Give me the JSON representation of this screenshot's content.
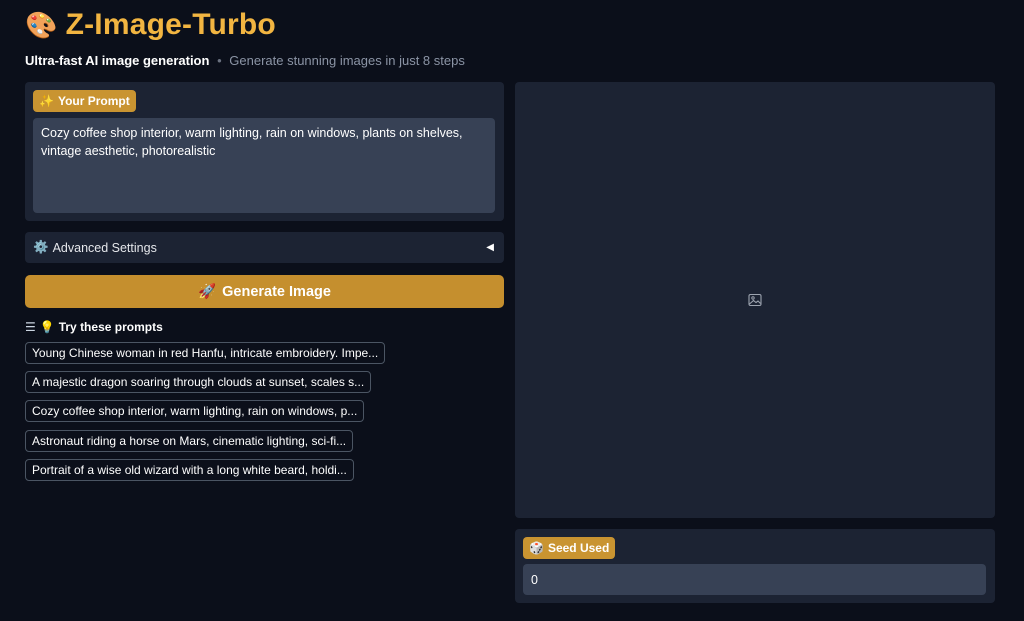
{
  "header": {
    "logo_emoji": "🎨",
    "title": "Z-Image-Turbo",
    "subtitle_strong": "Ultra-fast AI image generation",
    "subtitle_sep": "•",
    "subtitle_muted": "Generate stunning images in just 8 steps"
  },
  "prompt": {
    "badge_icon": "✨",
    "label": "Your Prompt",
    "value": "Cozy coffee shop interior, warm lighting, rain on windows, plants on shelves, vintage aesthetic, photorealistic"
  },
  "advanced": {
    "icon": "⚙️",
    "label": "Advanced Settings",
    "arrow": "◀"
  },
  "generate": {
    "icon": "🚀",
    "label": "Generate Image"
  },
  "examples": {
    "list_icon": "☰",
    "bulb_icon": "💡",
    "label": "Try these prompts",
    "items": [
      "Young Chinese woman in red Hanfu, intricate embroidery. Impe...",
      "A majestic dragon soaring through clouds at sunset, scales s...",
      "Cozy coffee shop interior, warm lighting, rain on windows, p...",
      "Astronaut riding a horse on Mars, cinematic lighting, sci-fi...",
      "Portrait of a wise old wizard with a long white beard, holdi..."
    ]
  },
  "output": {
    "placeholder_icon": "image-icon"
  },
  "seed": {
    "icon": "🎲",
    "label": "Seed Used",
    "value": "0"
  },
  "colors": {
    "background": "#0b0f1a",
    "panel": "#1c2333",
    "input": "#374155",
    "accent": "#c58f2e",
    "title": "#f2b541"
  }
}
